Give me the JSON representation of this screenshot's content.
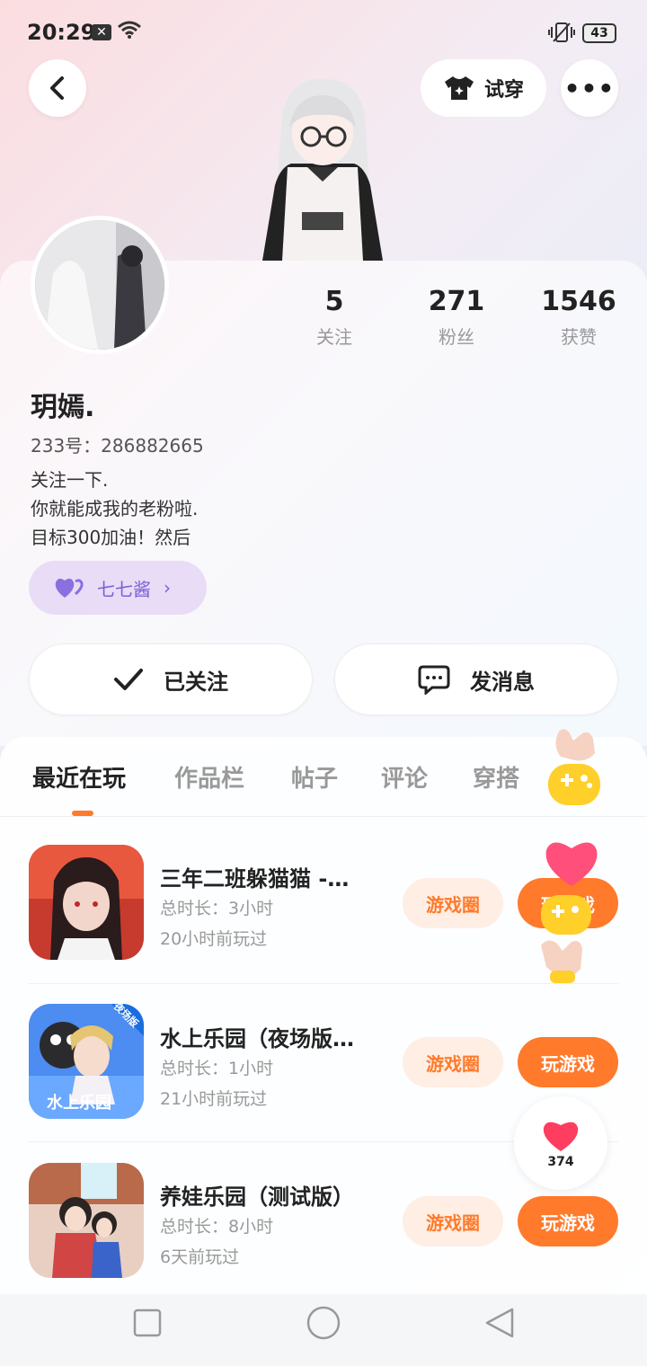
{
  "status_bar": {
    "time": "20:29",
    "battery": "43"
  },
  "header": {
    "tryon_label": "试穿"
  },
  "stats": [
    {
      "value": "5",
      "label": "关注"
    },
    {
      "value": "271",
      "label": "粉丝"
    },
    {
      "value": "1546",
      "label": "获赞"
    }
  ],
  "profile": {
    "name": "玥嫣.",
    "uid": "233号：286882665",
    "bio_line1": "关注一下.",
    "bio_line2": "你就能成我的老粉啦.",
    "bio_line3": "目标300加油！然后",
    "tag": "七七酱"
  },
  "actions": {
    "followed": "已关注",
    "message": "发消息"
  },
  "tabs": [
    "最近在玩",
    "作品栏",
    "帖子",
    "评论",
    "穿搭"
  ],
  "games": [
    {
      "title": "三年二班躲猫猫 -…",
      "duration": "总时长：3小时",
      "last_played": "20小时前玩过",
      "circle_btn": "游戏圈",
      "play_btn": "玩游戏"
    },
    {
      "title": "水上乐园（夜场版…",
      "duration": "总时长：1小时",
      "last_played": "21小时前玩过",
      "circle_btn": "游戏圈",
      "play_btn": "玩游戏",
      "icon_label": "水上乐园",
      "icon_badge": "夜场版"
    },
    {
      "title": "养娃乐园（测试版）",
      "duration": "总时长：8小时",
      "last_played": "6天前玩过",
      "circle_btn": "游戏圈",
      "play_btn": "玩游戏"
    }
  ],
  "like_float": {
    "count": "374"
  },
  "colors": {
    "accent": "#ff7a2b",
    "tag_purple": "#7b5fd3"
  }
}
